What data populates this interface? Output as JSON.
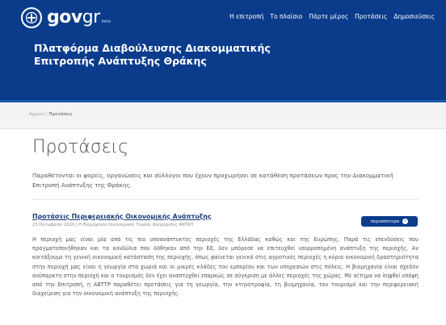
{
  "header": {
    "logo": {
      "text_main": "gov",
      "text_accent": "gr",
      "tag": "beta"
    },
    "nav": [
      "Η επιτροπή",
      "Το πλαίσιο",
      "Πάρτε μέρος",
      "Προτάσεις",
      "Δημοσιεύσεις"
    ],
    "platform_title": "Πλατφόρμα Διαβούλευσης Διακομματικής Επιτροπής Ανάπτυξης Θράκης"
  },
  "breadcrumb": {
    "home": "Αρχική",
    "separator": " / ",
    "current": "Προτάσεις"
  },
  "page": {
    "title": "Προτάσεις",
    "intro": "Παραθέτονται οι φορείς, οργανώσεις και σύλλογοι που έχουν προχωρήσει σε κατάθεση προτάσεων προς την Διακομματική Επιτροπή Ανάπτυξης της Θράκης."
  },
  "proposal": {
    "title": "Προτάσεις Περιφερειακής Οικονομικής Ανάπτυξης",
    "meta": "23 Οκτωβρίου 2020 | Η Βιομηχανία Οικονομικός Τομέας Διαχείρισης ΑΝΤΑΠ",
    "button_label": "περισσότερα",
    "body": "Η περιοχή μας είναι μία από τις πιο υποανάπτυκτες περιοχές της Ελλάδας καθώς και της Ευρώπης. Παρά τις επενδύσεις που πραγματοποιήθηκαν και τα κονδύλια που δόθηκαν από την ΕΕ, δεν μπόρεσε να επιτευχθεί ισορροπημένη ανάπτυξη της περιοχής. Αν κοιτάξουμε τη γενική οικονομική κατάσταση της περιοχής, όπως φαίνεται γενικά στις αγροτικές περιοχές η κύρια οικονομική δραστηριότητα στην περιοχή μας είναι η γεωργία στα χωριά και οι μικρές κλάδες του εμπορίου και των υπηρεσιών στις πόλεις. Η βιομηχανία είναι σχεδόν ανύπαρκτη στην περιοχή και ο τουρισμός δεν έχει αναπτυχθεί επαρκώς σε σύγκριση με άλλες περιοχές της χώρας. Με αίτημα να ληφθεί υπόψη από την Επιτροπή, η ΑΒΤΤΡ παραθέτει προτάσεις για τη γεωργία, την κτηνοτροφία, τη βιομηχανία, τον τουρισμό και την περιφερειακή διαχείριση για την οικονομική ανάπτυξη της περιοχής."
  }
}
